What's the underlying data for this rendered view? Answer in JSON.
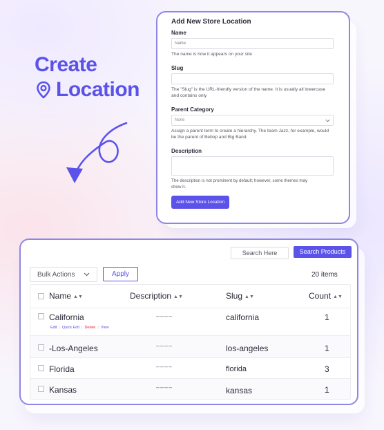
{
  "hero": {
    "line1": "Create",
    "line2": "Location"
  },
  "colors": {
    "accent": "#5b52ea",
    "border": "#8e86e6",
    "danger": "#e0283c"
  },
  "form": {
    "title": "Add New Store Location",
    "name_label": "Name",
    "name_placeholder": "Name",
    "name_help": "The name is how it appears on your site",
    "slug_label": "Slug",
    "slug_help": "The \"Slug\" is the URL-friendly version of the name. It is usually all lowercase and contains only",
    "parent_label": "Parent Category",
    "parent_value": "None",
    "parent_help": "Assign a parent term to create a hierarchy. The team Jazz, for example, would be the parent of Bebop and Big Band.",
    "description_label": "Description",
    "description_help": "The description is not prominent by default; however, some themes may show it.",
    "submit_label": "Add New Store Location"
  },
  "table": {
    "search_placeholder": "Search Here",
    "search_button": "Search Products",
    "bulk_actions": "Bulk Actions",
    "apply": "Apply",
    "items_count": "20 items",
    "columns": {
      "name": "Name",
      "description": "Description",
      "slug": "Slug",
      "count": "Count"
    },
    "row_actions": {
      "edit": "Edit",
      "quick_edit": "Quick Edit",
      "delete": "Delete",
      "view": "View"
    },
    "rows": [
      {
        "name": "California",
        "description": "––––",
        "slug": "california",
        "count": "1"
      },
      {
        "name": "-Los-Angeles",
        "description": "––––",
        "slug": "los-angeles",
        "count": "1"
      },
      {
        "name": "Florida",
        "description": "––––",
        "slug": "florida",
        "count": "3"
      },
      {
        "name": "Kansas",
        "description": "––––",
        "slug": "kansas",
        "count": "1"
      }
    ]
  }
}
